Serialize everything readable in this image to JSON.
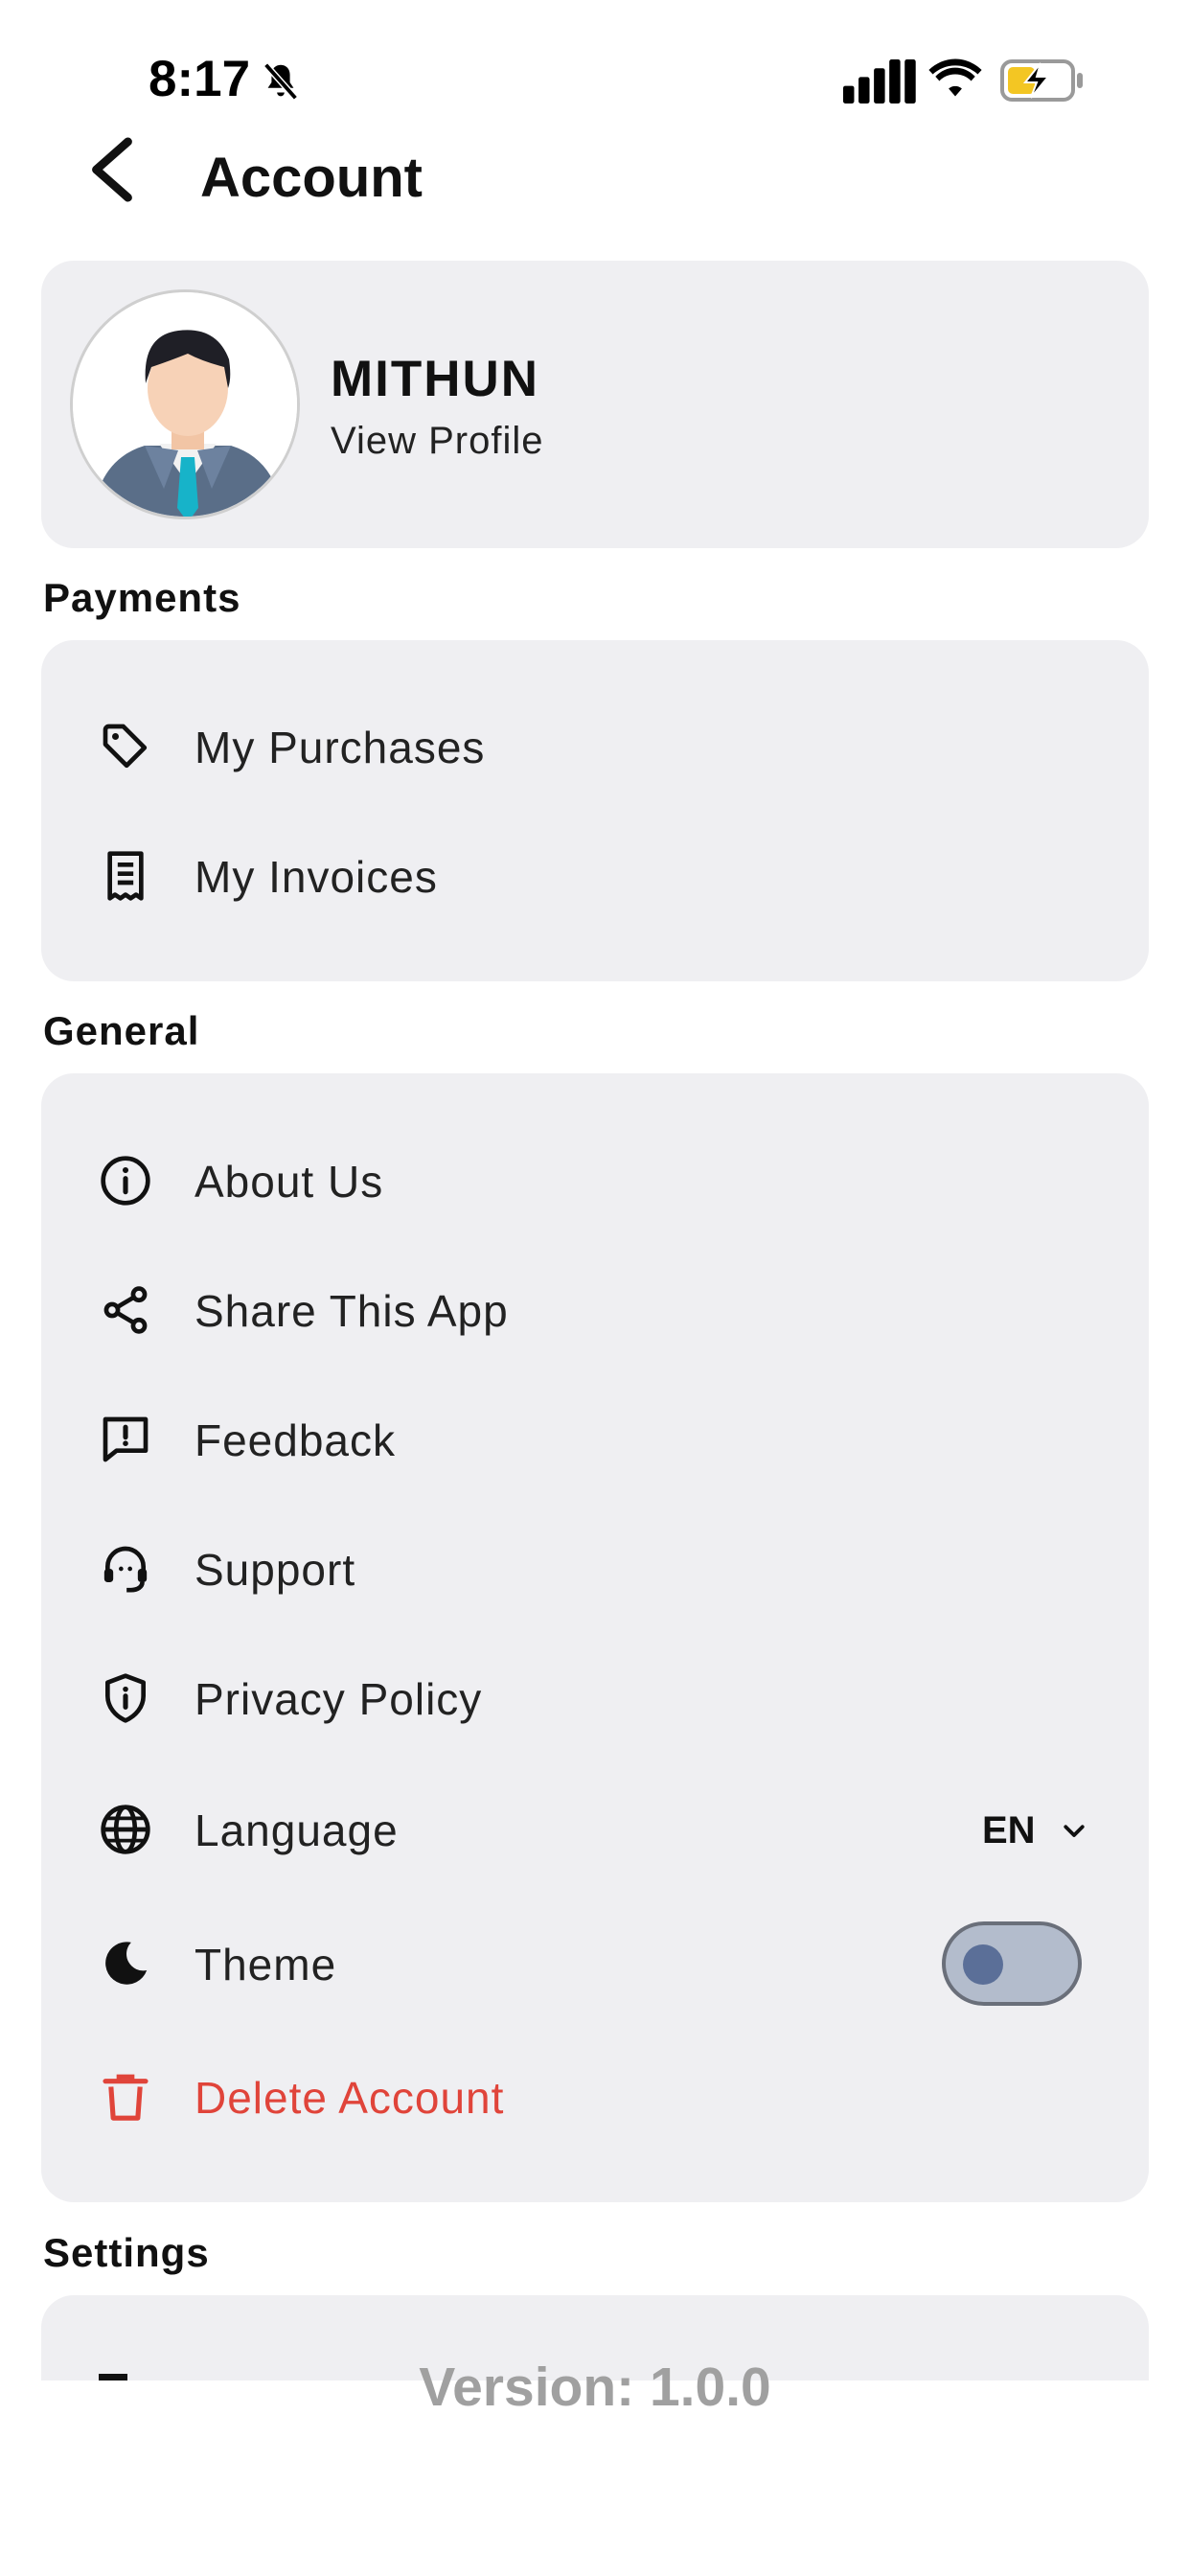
{
  "status_bar": {
    "time": "8:17",
    "icons": [
      "bell-muted-icon",
      "cellular-signal-icon",
      "wifi-icon",
      "battery-charging-icon"
    ]
  },
  "header": {
    "title": "Account",
    "back_icon": "chevron-left-icon"
  },
  "profile": {
    "name": "MITHUN",
    "subtitle": "View Profile"
  },
  "sections": {
    "payments": {
      "title": "Payments",
      "items": [
        {
          "label": "My Purchases",
          "icon": "tag-icon"
        },
        {
          "label": "My Invoices",
          "icon": "receipt-icon"
        }
      ]
    },
    "general": {
      "title": "General",
      "items": [
        {
          "label": "About Us",
          "icon": "info-icon"
        },
        {
          "label": "Share This App",
          "icon": "share-icon"
        },
        {
          "label": "Feedback",
          "icon": "feedback-icon"
        },
        {
          "label": "Support",
          "icon": "headset-icon"
        },
        {
          "label": "Privacy Policy",
          "icon": "shield-icon"
        },
        {
          "label": "Language",
          "icon": "globe-icon",
          "value": "EN"
        },
        {
          "label": "Theme",
          "icon": "moon-icon",
          "toggle_on": false
        },
        {
          "label": "Delete Account",
          "icon": "trash-icon"
        }
      ]
    },
    "settings": {
      "title": "Settings"
    }
  },
  "footer": {
    "version": "Version: 1.0.0"
  },
  "colors": {
    "card_bg": "#efeff2",
    "danger": "#e0443a",
    "toggle_track": "#b3bccc",
    "toggle_knob": "#5b6f98",
    "version_text": "#a0a0a0"
  }
}
